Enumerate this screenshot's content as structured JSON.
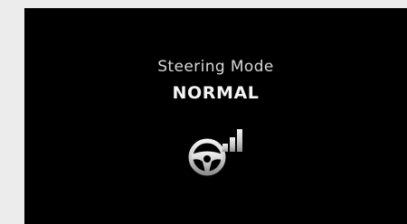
{
  "display": {
    "title": "Steering Mode",
    "mode": "NORMAL",
    "icon": "steering-wheel-signal-bars-icon",
    "mode_level": 2,
    "mode_level_max": 3
  },
  "colors": {
    "background": "#000000",
    "text": "#f4f4f4",
    "icon": "#d9d9d9"
  }
}
